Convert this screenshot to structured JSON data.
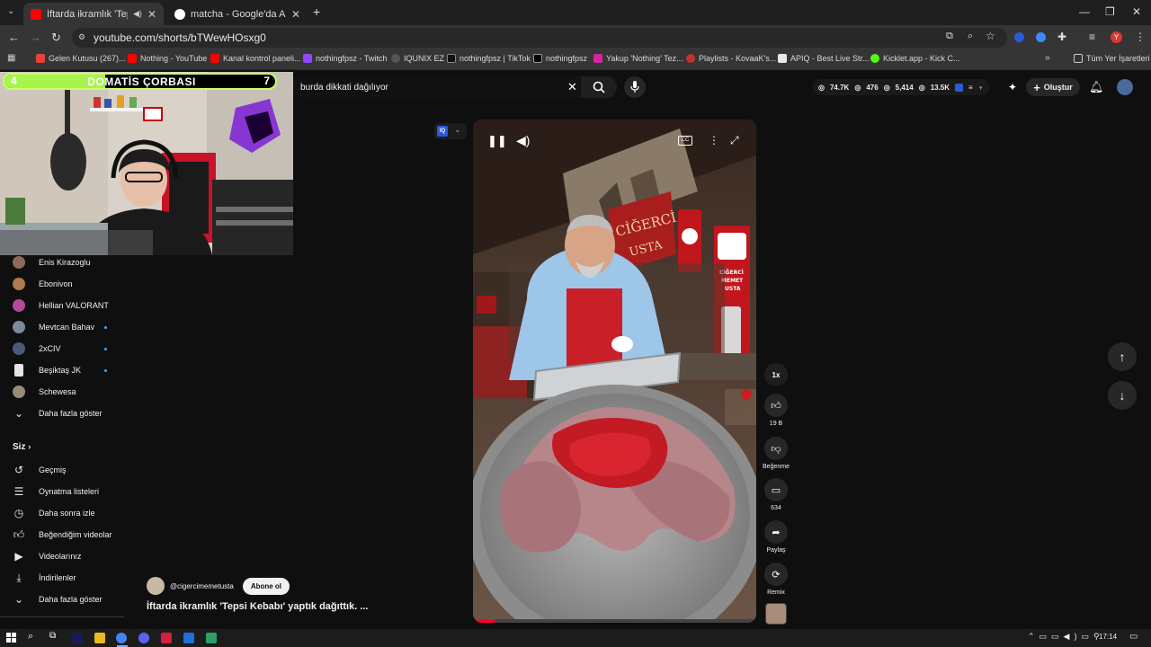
{
  "browser": {
    "tabs": [
      {
        "title": "İftarda ikramlık 'Tepsi Kebab",
        "active": true
      },
      {
        "title": "matcha - Google'da Ara",
        "active": false
      }
    ],
    "url": "youtube.com/shorts/bTWewHOsxg0",
    "bookmarks": [
      "Gelen Kutusu (267)...",
      "Nothing - YouTube",
      "Kanal kontrol paneli...",
      "nothingfpsz - Twitch",
      "IQUNIX EZ",
      "nothingfpsz | TikTok",
      "nothingfpsz",
      "Yakup 'Nothing' Tez...",
      "Playlists - KovaaK's...",
      "APIQ - Best Live Str...",
      "Kicklet.app - Kick C...",
      "Tüm Yer İşaretleri"
    ]
  },
  "overlay": {
    "left_count": "4",
    "title": "DOMATİS ÇORBASI",
    "right_count": "7"
  },
  "sidebar": {
    "subscriptions": [
      {
        "name": "Enis Kirazoglu",
        "dot": false,
        "color": "#8a6b5a"
      },
      {
        "name": "Ebonivon",
        "dot": false,
        "color": "#b07a4c"
      },
      {
        "name": "Hellian VALORANT",
        "dot": false,
        "color": "#b34a9a"
      },
      {
        "name": "Mevtcan Bahav",
        "dot": true,
        "color": "#7d8a9a"
      },
      {
        "name": "2xCIV",
        "dot": true,
        "color": "#4a5a7a"
      },
      {
        "name": "Beşiktaş JK",
        "dot": true,
        "color": "#e5e5e5"
      },
      {
        "name": "Schewesa",
        "dot": false,
        "color": "#9a8a7a"
      }
    ],
    "show_more": "Daha fazla göster",
    "you_section": "Siz",
    "you_items": [
      {
        "label": "Geçmiş",
        "icon": "history-icon"
      },
      {
        "label": "Oynatma listeleri",
        "icon": "playlist-icon"
      },
      {
        "label": "Daha sonra izle",
        "icon": "watch-later-icon"
      },
      {
        "label": "Beğendiğim videolar",
        "icon": "liked-icon"
      },
      {
        "label": "Videolarınız",
        "icon": "your-videos-icon"
      },
      {
        "label": "İndirilenler",
        "icon": "downloads-icon"
      }
    ],
    "show_more_2": "Daha fazla göster"
  },
  "search": {
    "query": "burda dikkati dağılıyor"
  },
  "stats": {
    "views": "74.7K",
    "a": "476",
    "b": "5,414",
    "c": "13.5K"
  },
  "create_label": "Oluştur",
  "actions": {
    "speed": "1x",
    "likes": "19 B",
    "dislike_label": "Beğenme",
    "comments": "634",
    "share_label": "Paylaş",
    "remix_label": "Remix"
  },
  "channel": {
    "handle": "@cigercimemetusta",
    "subscribe": "Abone ol",
    "video_title": "İftarda ikramlık 'Tepsi Kebabı' yaptık dağıttık. ..."
  },
  "video_signs": {
    "sign1": "CİĞERCİ USTA",
    "sign2": "CİĞERCİ MEMET USTA"
  },
  "taskbar": {
    "time": "17:14"
  }
}
